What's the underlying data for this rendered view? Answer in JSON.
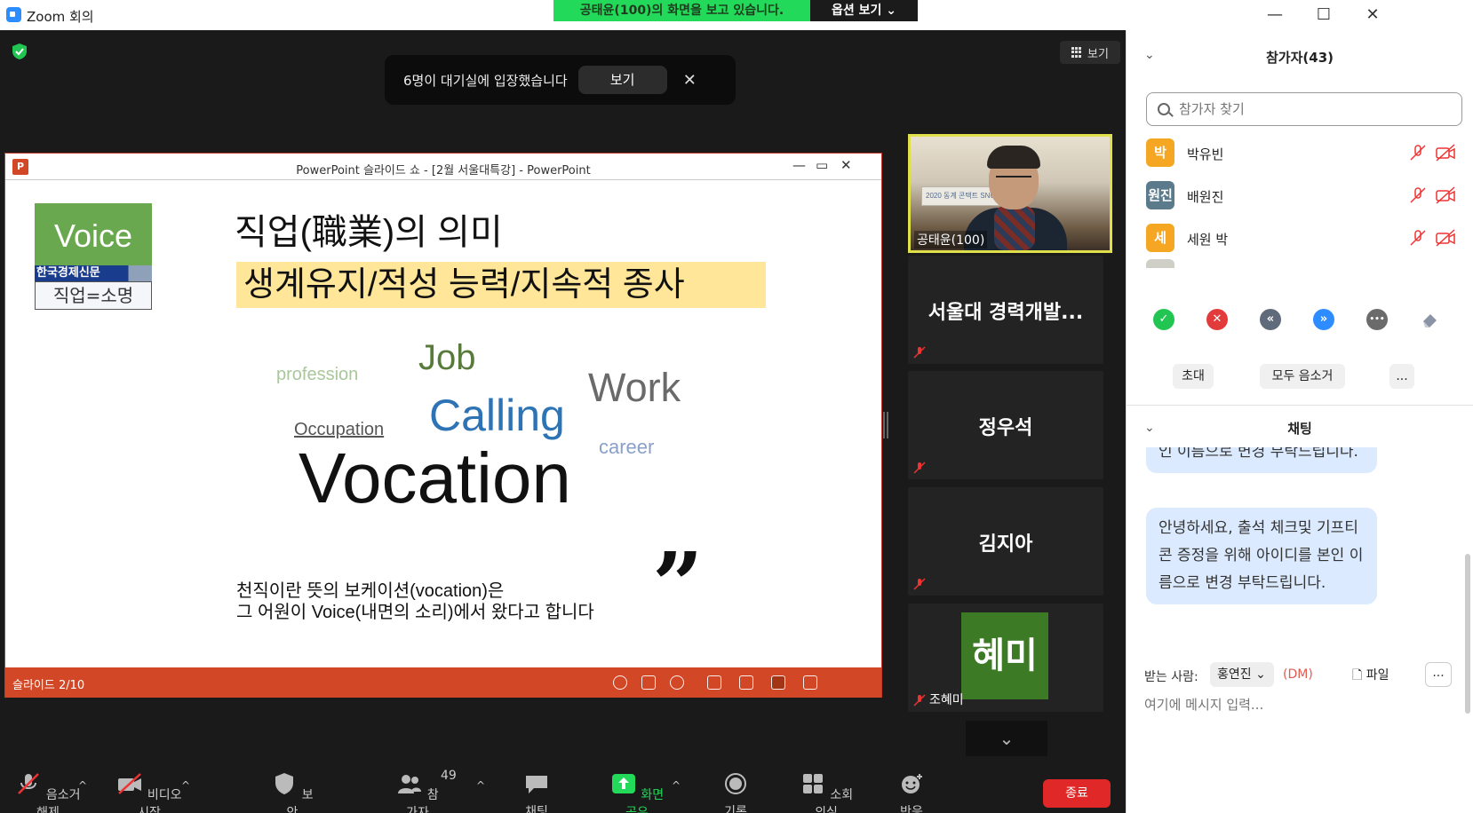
{
  "window": {
    "title": "Zoom 회의",
    "minimize": "—",
    "maximize": "☐",
    "close": "✕"
  },
  "share_banner": {
    "message": "공태윤(100)의 화면을 보고 있습니다.",
    "options": "옵션 보기 ⌄"
  },
  "stage": {
    "view_label": "보기",
    "waiting_room": {
      "message": "6명이 대기실에 입장했습니다",
      "view_button": "보기",
      "close": "✕"
    }
  },
  "powerpoint": {
    "window_title": "PowerPoint 슬라이드 쇼 - [2월 서울대특강] - PowerPoint",
    "icon_letter": "P",
    "slide_number": "슬라이드 2/10",
    "slide": {
      "voice_logo": "Voice",
      "newspaper": "한국경제신문",
      "motto": "직업=소명",
      "title": "직업(職業)의 의미",
      "highlight": "생계유지/적성 능력/지속적 종사",
      "words": {
        "profession": "profession",
        "job": "Job",
        "work": "Work",
        "occupation": "Occupation",
        "calling": "Calling",
        "career": "career",
        "vocation": "Vocation"
      },
      "quote_line1": "천직이란 뜻의 보케이션(vocation)은",
      "quote_line2": "그 어원이 Voice(내면의 소리)에서 왔다고 합니다",
      "quote_mark": "”"
    }
  },
  "video_tiles": {
    "speaker_name": "공태윤(100)",
    "speaker_banner": "2020 동계 콘택트 SNU",
    "tiles": [
      {
        "name": "서울대 경력개발..."
      },
      {
        "name": "정우석"
      },
      {
        "name": "김지아"
      }
    ],
    "hyemi_avatar": "혜미",
    "hyemi_name": "조혜미",
    "scroll_down": "⌄"
  },
  "toolbar": {
    "unmute": "음소거 해제",
    "start_video": "비디오 시작",
    "security": "보안",
    "participants": "참가자",
    "participant_count": "49",
    "chat": "채팅",
    "share_screen": "화면 공유",
    "record": "기록",
    "breakout": "소회의실",
    "reactions": "반응",
    "end": "종료",
    "caret": "^"
  },
  "panel": {
    "participants_title": "참가자(43)",
    "search_placeholder": "참가자 찾기",
    "participants": [
      {
        "avatar": "박",
        "name": "박유빈",
        "color": "#f5a623"
      },
      {
        "avatar": "원진",
        "name": "배원진",
        "color": "#5b7b8c"
      },
      {
        "avatar": "세",
        "name": "세원 박",
        "color": "#f5a623"
      }
    ],
    "reactions": {
      "yes": "✓",
      "no": "✕",
      "slower": "«",
      "faster": "»",
      "more": "•••"
    },
    "invite": "초대",
    "mute_all": "모두 음소거",
    "more": "...",
    "chat_title": "채팅",
    "chat_messages": [
      {
        "text": "인 이름으로 변경 부탁드립니다."
      },
      {
        "text": "안녕하세요, 출석 체크및 기프티콘 증정을 위해 아이디를 본인 이름으로 변경 부탁드립니다."
      }
    ],
    "to_label": "받는 사람:",
    "to_value": "홍연진 ⌄",
    "dm": "(DM)",
    "file": "파일",
    "file_more": "...",
    "message_placeholder": "여기에 메시지 입력..."
  },
  "colors": {
    "accent_blue": "#2d8cff",
    "share_green": "#23d959",
    "end_red": "#e02828",
    "ppt_orange": "#d24726"
  }
}
